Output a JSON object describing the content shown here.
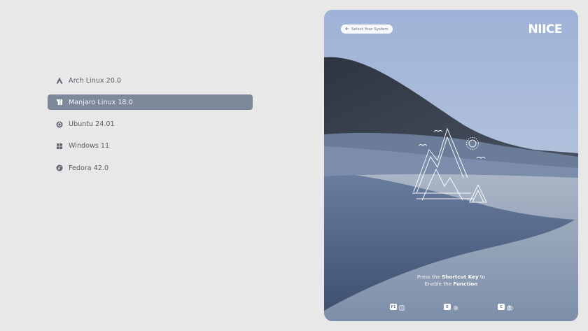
{
  "menu": {
    "items": [
      {
        "label": "Arch Linux 20.0",
        "icon": "arch-icon",
        "selected": false
      },
      {
        "label": "Manjaro Linux 18.0",
        "icon": "manjaro-icon",
        "selected": true
      },
      {
        "label": "Ubuntu 24.01",
        "icon": "ubuntu-icon",
        "selected": false
      },
      {
        "label": "Windows 11",
        "icon": "windows-icon",
        "selected": false
      },
      {
        "label": "Fedora 42.0",
        "icon": "fedora-icon",
        "selected": false
      }
    ]
  },
  "panel": {
    "back_label": "Select Your System",
    "brand": "NIICE",
    "hint": {
      "line1_prefix": "Press the ",
      "line1_bold": "Shortcut Key",
      "line1_suffix": " to",
      "line2_prefix": "Enable the ",
      "line2_bold": "Function"
    },
    "keys": [
      {
        "cap": "F1",
        "function": "info-icon"
      },
      {
        "cap": "E",
        "function": "settings-icon"
      },
      {
        "cap": "C",
        "function": "camera-icon"
      }
    ]
  },
  "colors": {
    "background": "#e8e8e8",
    "selected": "#7d889b",
    "text": "#585d67",
    "accent_white": "#ffffff"
  }
}
